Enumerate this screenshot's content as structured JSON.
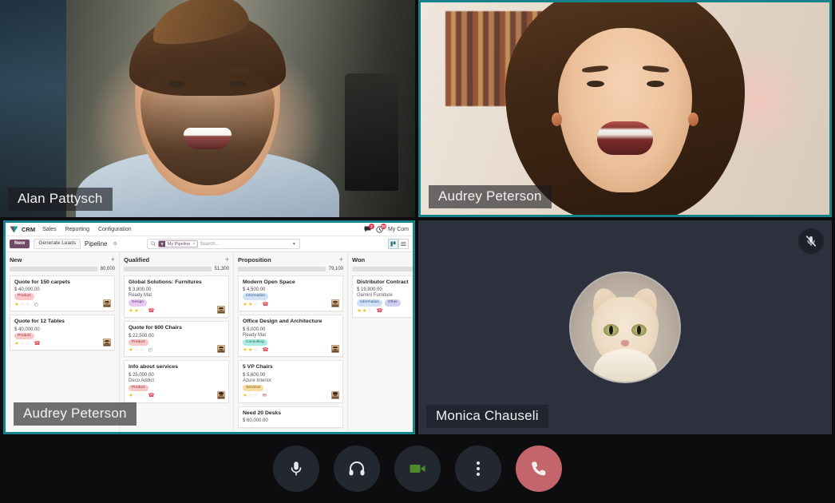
{
  "meeting": {
    "participants": [
      {
        "name": "Alan Pattysch",
        "camera_on": true,
        "speaking": false,
        "tile": "video"
      },
      {
        "name": "Audrey Peterson",
        "camera_on": true,
        "speaking": true,
        "tile": "video"
      },
      {
        "name": "Audrey Peterson",
        "camera_on": true,
        "speaking": true,
        "tile": "screen-share"
      },
      {
        "name": "Monica Chauseli",
        "camera_on": false,
        "speaking": false,
        "tile": "avatar",
        "muted": true,
        "avatar": "cat-photo"
      }
    ],
    "controls": [
      {
        "id": "microphone",
        "icon": "microphone-icon",
        "label": "Microphone",
        "state": "on"
      },
      {
        "id": "headphones",
        "icon": "headphones-icon",
        "label": "Headphones",
        "state": "on"
      },
      {
        "id": "camera",
        "icon": "video-camera-icon",
        "label": "Camera",
        "state": "on",
        "color": "#4d8b2b"
      },
      {
        "id": "more",
        "icon": "more-options-icon",
        "label": "More options"
      },
      {
        "id": "hangup",
        "icon": "phone-hangup-icon",
        "label": "Leave call",
        "color": "#c4656b"
      }
    ],
    "mute_badge_icon": "microphone-muted-icon",
    "active_border_color": "#17818c"
  },
  "odoo": {
    "topbar": {
      "app_name": "CRM",
      "menus": [
        "Sales",
        "Reporting",
        "Configuration"
      ],
      "messages_icon": "messages-icon",
      "messages_badge": "3",
      "activities_icon": "activities-clock-icon",
      "activities_badge": "20",
      "user_label": "My Com"
    },
    "controlpanel": {
      "new_button": "New",
      "generate_leads_button": "Generate Leads",
      "breadcrumb": "Pipeline",
      "gear_icon": "gear-icon",
      "search": {
        "magnifier_icon": "search-icon",
        "facet_icon": "filter-icon",
        "facet_label": "My Pipeline",
        "facet_remove": "×",
        "placeholder": "Search...",
        "caret_icon": "chevron-down-icon"
      },
      "views": [
        {
          "id": "kanban",
          "icon": "kanban-view-icon",
          "active": true
        },
        {
          "id": "list",
          "icon": "list-view-icon",
          "active": false
        }
      ]
    },
    "columns": [
      {
        "title": "New",
        "amount": "80,000",
        "progress_pct": 50,
        "add_icon": "plus-icon",
        "cards": [
          {
            "title": "Quote for 150 carpets",
            "amount": "$ 40,000.00",
            "partner": "",
            "tags": [
              {
                "label": "Product",
                "style": "tag-product"
              }
            ],
            "stars_filled": 1,
            "activity_icon": "clock-icon",
            "activity_class": "act-clock",
            "avatar": "user-avatar"
          },
          {
            "title": "Quote for 12 Tables",
            "amount": "$ 40,000.00",
            "partner": "",
            "tags": [
              {
                "label": "Product",
                "style": "tag-product"
              }
            ],
            "stars_filled": 1,
            "activity_icon": "phone-icon",
            "activity_class": "act-phone",
            "avatar": "user-avatar"
          }
        ]
      },
      {
        "title": "Qualified",
        "amount": "51,300",
        "progress_pct": 66,
        "add_icon": "plus-icon",
        "cards": [
          {
            "title": "Global Solutions: Furnitures",
            "amount": "$ 3,800.00",
            "partner": "Ready Mat",
            "tags": [
              {
                "label": "Design",
                "style": "tag-design"
              }
            ],
            "stars_filled": 2,
            "activity_icon": "phone-icon",
            "activity_class": "act-phone",
            "avatar": "user-avatar"
          },
          {
            "title": "Quote for 600 Chairs",
            "amount": "$ 22,500.00",
            "partner": "",
            "tags": [
              {
                "label": "Product",
                "style": "tag-product"
              }
            ],
            "stars_filled": 1,
            "activity_icon": "clock-icon",
            "activity_class": "act-clock",
            "avatar": "user-avatar"
          },
          {
            "title": "Info about services",
            "amount": "$ 25,000.00",
            "partner": "Deco Addict",
            "tags": [
              {
                "label": "Product",
                "style": "tag-product"
              }
            ],
            "stars_filled": 1,
            "activity_icon": "phone-icon",
            "activity_class": "act-phone",
            "avatar": "user-avatar"
          }
        ]
      },
      {
        "title": "Proposition",
        "amount": "79,100",
        "progress_pct": 100,
        "add_icon": "plus-icon",
        "cards": [
          {
            "title": "Modern Open Space",
            "amount": "$ 4,500.00",
            "partner": "",
            "tags": [
              {
                "label": "Information",
                "style": "tag-info"
              }
            ],
            "stars_filled": 2,
            "activity_icon": "phone-icon",
            "activity_class": "act-phone",
            "avatar": "user-avatar"
          },
          {
            "title": "Office Design and Architecture",
            "amount": "$ 9,000.00",
            "partner": "Ready Mat",
            "tags": [
              {
                "label": "Consulting",
                "style": "tag-consult"
              }
            ],
            "stars_filled": 2,
            "activity_icon": "phone-icon",
            "activity_class": "act-phone",
            "avatar": "user-avatar"
          },
          {
            "title": "5 VP Chairs",
            "amount": "$ 5,600.00",
            "partner": "Azure Interior",
            "tags": [
              {
                "label": "Services",
                "style": "tag-services"
              }
            ],
            "stars_filled": 1,
            "activity_icon": "mail-icon",
            "activity_class": "act-mail",
            "avatar": "user-avatar"
          },
          {
            "title": "Need 20 Desks",
            "amount": "$ 60,000.00",
            "partner": "",
            "tags": [],
            "stars_filled": 0,
            "activity_icon": "",
            "activity_class": "",
            "avatar": ""
          }
        ]
      },
      {
        "title": "Won",
        "amount": "",
        "progress_pct": 100,
        "add_icon": "",
        "cards": [
          {
            "title": "Distributor Contract",
            "amount": "$ 19,800.00",
            "partner": "Gemini Furniture",
            "tags": [
              {
                "label": "Information",
                "style": "tag-info"
              },
              {
                "label": "Other",
                "style": "tag-other"
              }
            ],
            "stars_filled": 2,
            "activity_icon": "phone-icon",
            "activity_class": "act-phone",
            "avatar": ""
          }
        ]
      }
    ]
  }
}
